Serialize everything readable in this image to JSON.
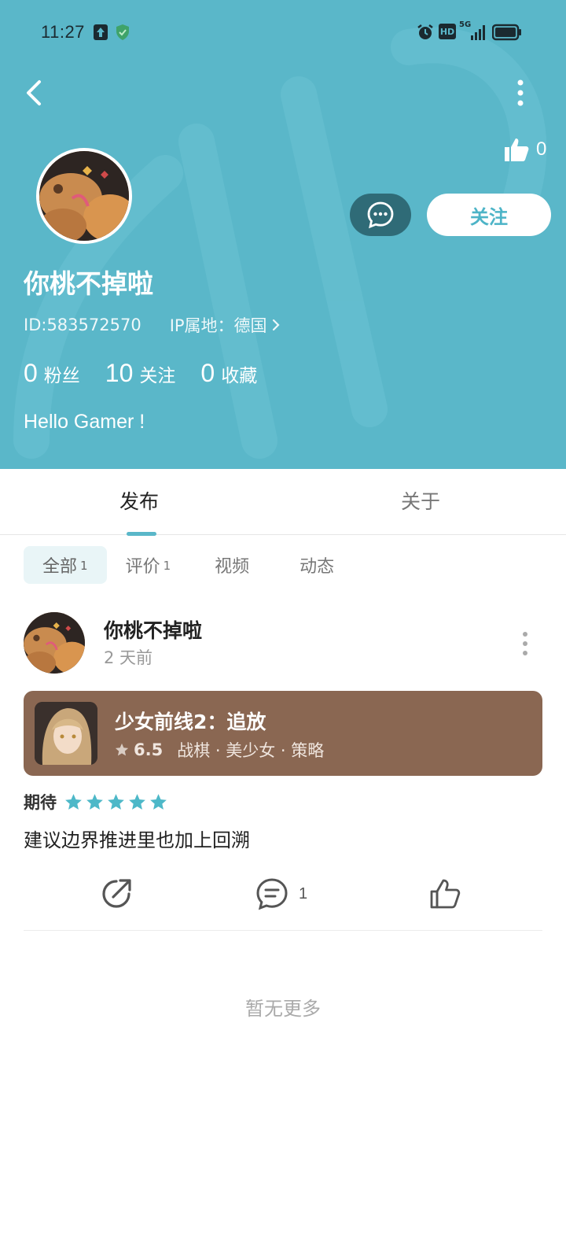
{
  "status_bar": {
    "time": "11:27",
    "network": "5G",
    "hd_label": "HD"
  },
  "header": {
    "likes_count": "0",
    "follow_label": "关注",
    "username": "你桃不掉啦",
    "id_text": "ID:583572570",
    "ip_text": "IP属地：德国",
    "stats": [
      {
        "num": "0",
        "label": "粉丝"
      },
      {
        "num": "10",
        "label": "关注"
      },
      {
        "num": "0",
        "label": "收藏"
      }
    ],
    "bio": "Hello Gamer !"
  },
  "tabs": [
    {
      "label": "发布",
      "active": true
    },
    {
      "label": "关于",
      "active": false
    }
  ],
  "filters": [
    {
      "label": "全部",
      "count": "1",
      "active": true
    },
    {
      "label": "评价",
      "count": "1",
      "active": false
    },
    {
      "label": "视频",
      "count": "",
      "active": false
    },
    {
      "label": "动态",
      "count": "",
      "active": false
    }
  ],
  "post": {
    "author": "你桃不掉啦",
    "time": "2 天前",
    "game": {
      "title": "少女前线2：追放",
      "score": "6.5",
      "tags": "战棋 · 美少女 · 策略",
      "card_color": "#8a6752"
    },
    "rating_label": "期待",
    "stars": 5,
    "review_text": "建议边界推进里也加上回溯",
    "comment_count": "1"
  },
  "footer_text": "暂无更多",
  "colors": {
    "accent": "#5ab7c9",
    "star": "#4db8c8",
    "msg_button": "#2f6b77"
  },
  "icons": [
    "back-arrow-icon",
    "more-vertical-icon",
    "thumbs-up-icon",
    "chat-bubble-icon",
    "share-icon",
    "comment-icon",
    "star-icon",
    "alarm-icon",
    "battery-icon",
    "signal-icon",
    "upload-icon",
    "shield-icon"
  ]
}
